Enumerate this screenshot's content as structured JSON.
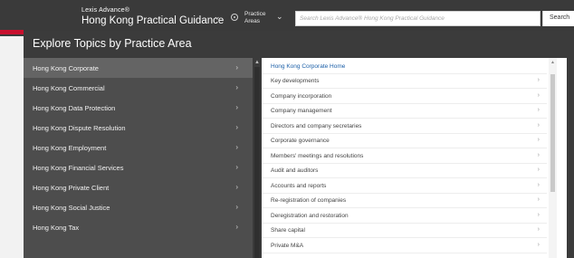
{
  "header": {
    "brand_small": "Lexis Advance®",
    "brand_title": "Hong Kong Practical Guidance",
    "practice_areas_label_1": "Practice",
    "practice_areas_label_2": "Areas",
    "search_placeholder": "Search Lexis Advance® Hong Kong Practical Guidance",
    "search_button": "Search"
  },
  "panel": {
    "title": "Explore Topics by Practice Area"
  },
  "practice_areas": [
    {
      "label": "Hong Kong Corporate",
      "selected": true
    },
    {
      "label": "Hong Kong Commercial",
      "selected": false
    },
    {
      "label": "Hong Kong Data Protection",
      "selected": false
    },
    {
      "label": "Hong Kong Dispute Resolution",
      "selected": false
    },
    {
      "label": "Hong Kong Employment",
      "selected": false
    },
    {
      "label": "Hong Kong Financial Services",
      "selected": false
    },
    {
      "label": "Hong Kong Private Client",
      "selected": false
    },
    {
      "label": "Hong Kong Social Justice",
      "selected": false
    },
    {
      "label": "Hong Kong Tax",
      "selected": false
    }
  ],
  "topics": [
    {
      "label": "Hong Kong Corporate Home",
      "link": true
    },
    {
      "label": "Key developments",
      "link": false
    },
    {
      "label": "Company incorporation",
      "link": false
    },
    {
      "label": "Company management",
      "link": false
    },
    {
      "label": "Directors and company secretaries",
      "link": false
    },
    {
      "label": "Corporate governance",
      "link": false
    },
    {
      "label": "Members' meetings and resolutions",
      "link": false
    },
    {
      "label": "Audit and auditors",
      "link": false
    },
    {
      "label": "Accounts and reports",
      "link": false
    },
    {
      "label": "Re-registration of companies",
      "link": false
    },
    {
      "label": "Deregistration and restoration",
      "link": false
    },
    {
      "label": "Share capital",
      "link": false
    },
    {
      "label": "Private M&A",
      "link": false
    }
  ],
  "icons": {
    "chevron": "›",
    "dropdown": "⌄",
    "scroll_up": "▲"
  },
  "colors": {
    "topbar": "#3a3a3a",
    "accent_red": "#c8102e",
    "link_blue": "#1b5fa8"
  }
}
